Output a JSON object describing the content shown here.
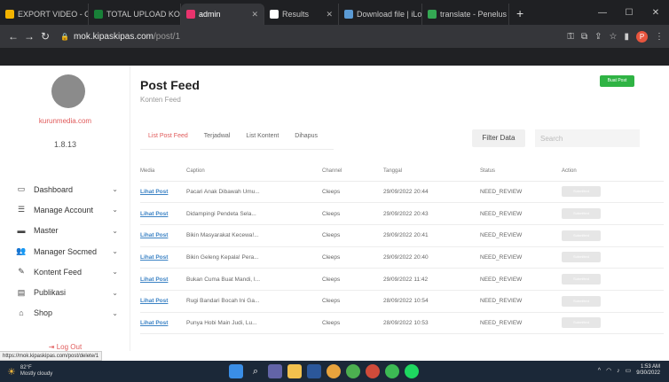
{
  "browser": {
    "tabs": [
      {
        "title": "EXPORT VIDEO - G",
        "color": "#f4b400",
        "active": false
      },
      {
        "title": "TOTAL UPLOAD KO",
        "color": "#188038",
        "active": false
      },
      {
        "title": "admin",
        "color": "#e8336d",
        "active": true
      },
      {
        "title": "Results",
        "color": "#ffffff",
        "active": false
      },
      {
        "title": "Download file | iLo",
        "color": "#5b9bd5",
        "active": false
      },
      {
        "title": "translate - Penelus",
        "color": "#34a853",
        "active": false
      }
    ],
    "new_tab": "+",
    "url_domain": "mok.kipaskipas.com",
    "url_path": "/post/1",
    "profile_initial": "P"
  },
  "sidebar": {
    "brand": "kurunmedia.com",
    "version": "1.8.13",
    "items": [
      {
        "label": "Dashboard",
        "icon": "monitor-icon",
        "glyph": "▭"
      },
      {
        "label": "Manage Account",
        "icon": "sliders-icon",
        "glyph": "☰"
      },
      {
        "label": "Master",
        "icon": "folder-icon",
        "glyph": "▬"
      },
      {
        "label": "Manager Socmed",
        "icon": "users-icon",
        "glyph": "👥"
      },
      {
        "label": "Kontent Feed",
        "icon": "pen-icon",
        "glyph": "✎"
      },
      {
        "label": "Publikasi",
        "icon": "list-icon",
        "glyph": "▤"
      },
      {
        "label": "Shop",
        "icon": "gift-icon",
        "glyph": "⌂"
      }
    ],
    "logout": "Log Out"
  },
  "main": {
    "title": "Post Feed",
    "subtitle": "Konten Feed",
    "post_button": "Buat Post",
    "tabs": [
      "List Post Feed",
      "Terjadwal",
      "List Kontent",
      "Dihapus"
    ],
    "filter_button": "Filter Data",
    "search_placeholder": "Search",
    "table": {
      "headers": [
        "Media",
        "Caption",
        "Channel",
        "Tanggal",
        "Status",
        "Action"
      ],
      "rows": [
        {
          "media": "Lihat Post",
          "caption": "Pacari Anak Dibawah Umu...",
          "channel": "Cleeps",
          "date": "29/09/2022 20:44",
          "status": "NEED_REVIEW",
          "action": "Submitted"
        },
        {
          "media": "Lihat Post",
          "caption": "Didampingi Pendeta Sela...",
          "channel": "Cleeps",
          "date": "29/09/2022 20:43",
          "status": "NEED_REVIEW",
          "action": "Submitted"
        },
        {
          "media": "Lihat Post",
          "caption": "Bikin Masyarakat Kecewa!...",
          "channel": "Cleeps",
          "date": "29/09/2022 20:41",
          "status": "NEED_REVIEW",
          "action": "Submitted"
        },
        {
          "media": "Lihat Post",
          "caption": "Bikin Geleng Kepala! Pera...",
          "channel": "Cleeps",
          "date": "29/09/2022 20:40",
          "status": "NEED_REVIEW",
          "action": "Submitted"
        },
        {
          "media": "Lihat Post",
          "caption": "Bukan Cuma Buat Mandi, I...",
          "channel": "Cleeps",
          "date": "29/09/2022 11:42",
          "status": "NEED_REVIEW",
          "action": "Submitted"
        },
        {
          "media": "Lihat Post",
          "caption": "Rugi Bandari Bocah Ini Ga...",
          "channel": "Cleeps",
          "date": "28/09/2022 10:54",
          "status": "NEED_REVIEW",
          "action": "Submitted"
        },
        {
          "media": "Lihat Post",
          "caption": "Punya Hobi Main Judi, Lu...",
          "channel": "Cleeps",
          "date": "28/09/2022 10:53",
          "status": "NEED_REVIEW",
          "action": "Submitted"
        }
      ]
    }
  },
  "status_url": "https://mok.kipaskipas.com/post/delete/1",
  "taskbar": {
    "temperature": "82°F",
    "weather": "Mostly cloudy",
    "time": "1:53 AM",
    "date": "9/30/2022"
  },
  "colors": {
    "accent_red": "#e05a5a",
    "primary_green": "#2fb344",
    "link_blue": "#3b82c4"
  }
}
